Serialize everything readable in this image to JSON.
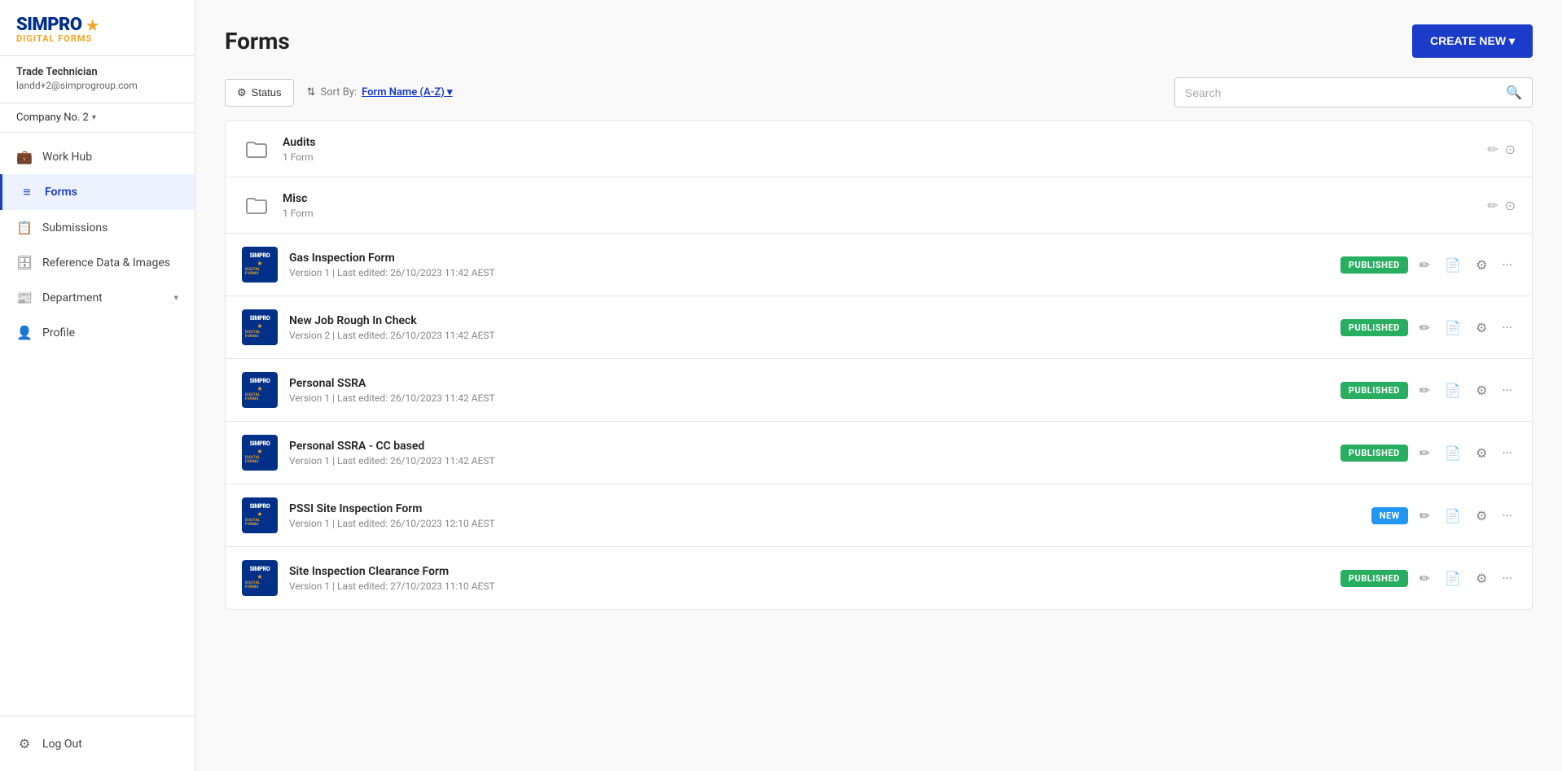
{
  "app": {
    "name": "SIMPRO",
    "star": "★",
    "tagline": "DIGITAL FORMS"
  },
  "user": {
    "name": "Trade Technician",
    "email": "landd+2@simprogroup.com",
    "company": "Company No. 2"
  },
  "sidebar": {
    "items": [
      {
        "id": "work-hub",
        "label": "Work Hub",
        "icon": "💼",
        "active": false
      },
      {
        "id": "forms",
        "label": "Forms",
        "icon": "≡",
        "active": true
      },
      {
        "id": "submissions",
        "label": "Submissions",
        "icon": "📋",
        "active": false
      },
      {
        "id": "reference-data",
        "label": "Reference Data & Images",
        "icon": "🗄",
        "active": false
      },
      {
        "id": "department",
        "label": "Department",
        "icon": "📰",
        "active": false,
        "hasChevron": true
      },
      {
        "id": "profile",
        "label": "Profile",
        "icon": "👤",
        "active": false
      }
    ],
    "bottom": [
      {
        "id": "logout",
        "label": "Log Out",
        "icon": "⚙"
      }
    ]
  },
  "page": {
    "title": "Forms",
    "create_new_label": "CREATE NEW ▾"
  },
  "toolbar": {
    "status_label": "Status",
    "sort_prefix": "Sort By:",
    "sort_value": "Form Name (A-Z) ▾"
  },
  "search": {
    "placeholder": "Search"
  },
  "folders": [
    {
      "id": "audits",
      "name": "Audits",
      "count": "1 Form"
    },
    {
      "id": "misc",
      "name": "Misc",
      "count": "1 Form"
    }
  ],
  "forms": [
    {
      "id": "gas-inspection",
      "name": "Gas Inspection Form",
      "meta": "Version 1 | Last edited: 26/10/2023 11:42 AEST",
      "status": "PUBLISHED",
      "status_type": "published"
    },
    {
      "id": "new-job-rough",
      "name": "New Job Rough In Check",
      "meta": "Version 2 | Last edited: 26/10/2023 11:42 AEST",
      "status": "PUBLISHED",
      "status_type": "published"
    },
    {
      "id": "personal-ssra",
      "name": "Personal SSRA",
      "meta": "Version 1 | Last edited: 26/10/2023 11:42 AEST",
      "status": "PUBLISHED",
      "status_type": "published"
    },
    {
      "id": "personal-ssra-cc",
      "name": "Personal SSRA - CC based",
      "meta": "Version 1 | Last edited: 26/10/2023 11:42 AEST",
      "status": "PUBLISHED",
      "status_type": "published"
    },
    {
      "id": "pssi-site",
      "name": "PSSI Site Inspection Form",
      "meta": "Version 1 | Last edited: 26/10/2023 12:10 AEST",
      "status": "NEW",
      "status_type": "new"
    },
    {
      "id": "site-inspection-clearance",
      "name": "Site Inspection Clearance Form",
      "meta": "Version 1 | Last edited: 27/10/2023 11:10 AEST",
      "status": "PUBLISHED",
      "status_type": "published"
    }
  ]
}
